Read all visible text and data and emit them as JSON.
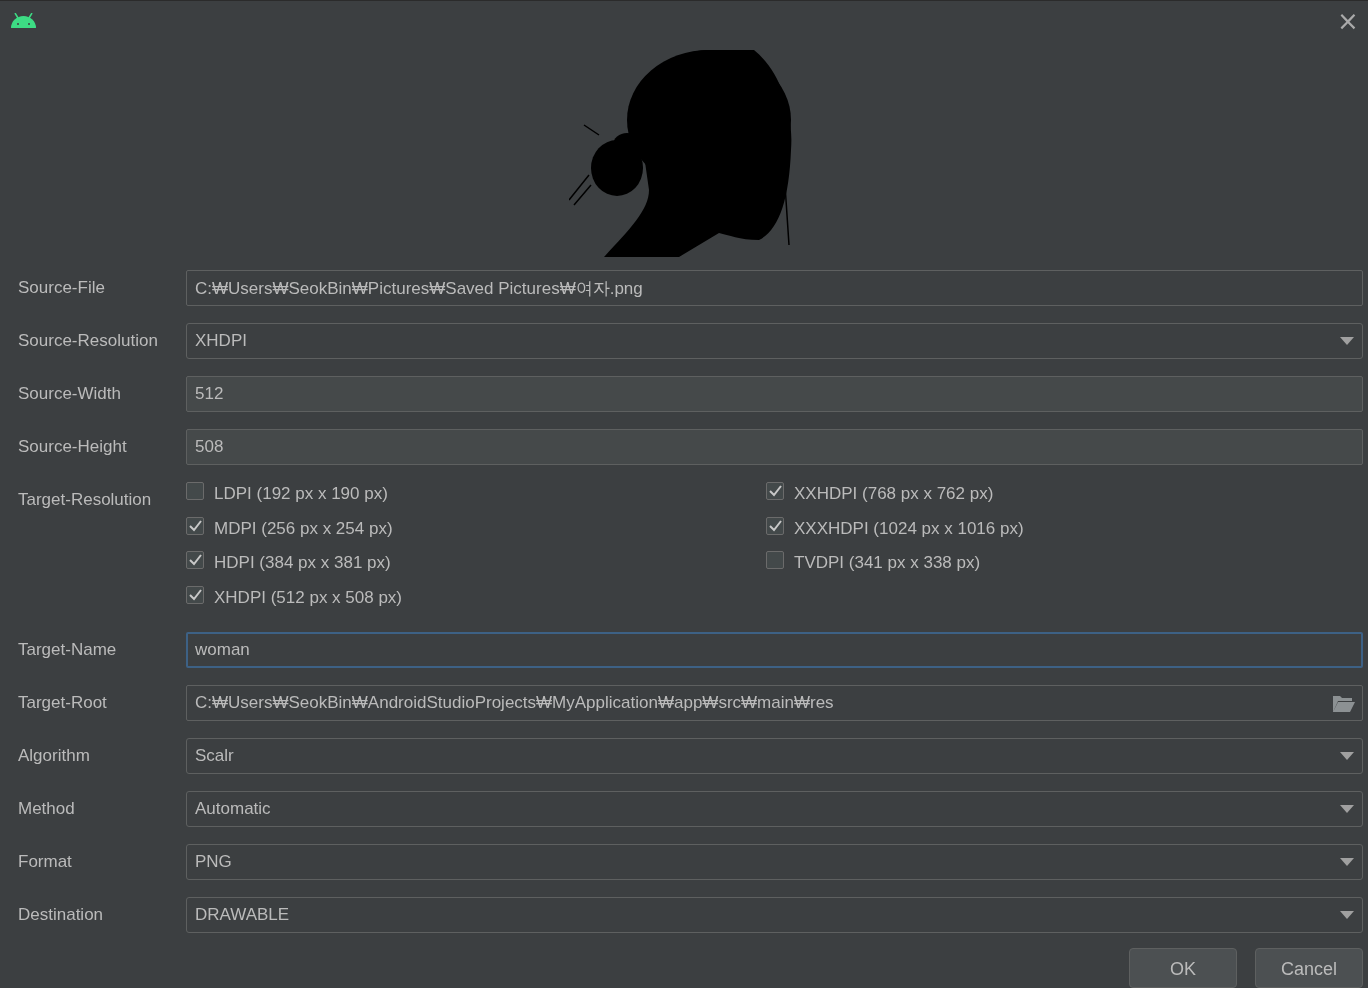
{
  "window": {
    "close": "×"
  },
  "fields": [
    {
      "kind": "text",
      "label": "Source-File",
      "value": "C:₩Users₩SeokBin₩Pictures₩Saved Pictures₩여자.png"
    },
    {
      "kind": "dropdown",
      "label": "Source-Resolution",
      "value": "XHDPI"
    },
    {
      "kind": "readonly",
      "label": "Source-Width",
      "value": "512"
    },
    {
      "kind": "readonly",
      "label": "Source-Height",
      "value": "508"
    },
    {
      "kind": "checkboxes",
      "label": "Target-Resolution",
      "options": [
        {
          "label": "LDPI (192 px x 190 px)",
          "checked": false
        },
        {
          "label": "MDPI (256 px x 254 px)",
          "checked": true
        },
        {
          "label": "HDPI (384 px x 381 px)",
          "checked": true
        },
        {
          "label": "XHDPI (512 px x 508 px)",
          "checked": true
        },
        {
          "label": "XXHDPI (768 px x 762 px)",
          "checked": true
        },
        {
          "label": "XXXHDPI (1024 px x 1016 px)",
          "checked": true
        },
        {
          "label": "TVDPI (341 px x 338 px)",
          "checked": false
        }
      ]
    },
    {
      "kind": "text",
      "label": "Target-Name",
      "value": "woman",
      "focused": true
    },
    {
      "kind": "path",
      "label": "Target-Root",
      "value": "C:₩Users₩SeokBin₩AndroidStudioProjects₩MyApplication₩app₩src₩main₩res"
    },
    {
      "kind": "dropdown",
      "label": "Algorithm",
      "value": "Scalr"
    },
    {
      "kind": "dropdown",
      "label": "Method",
      "value": "Automatic"
    },
    {
      "kind": "dropdown",
      "label": "Format",
      "value": "PNG"
    },
    {
      "kind": "dropdown",
      "label": "Destination",
      "value": "DRAWABLE"
    }
  ],
  "buttons": [
    "OK",
    "Cancel"
  ]
}
